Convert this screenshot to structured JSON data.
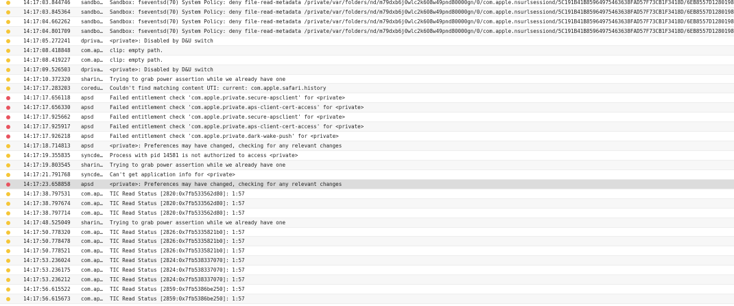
{
  "colors": {
    "info_dot": "#f5c637",
    "error_dot": "#e8535f",
    "selected_row": "#dcdcdc"
  },
  "log": {
    "rows": [
      {
        "time": "14:17:03.844746",
        "process": "sandbo…",
        "message": "Sandbox: fseventsd(70) System Policy: deny file-read-metadata /private/var/folders/nd/m79dxb6j0wlc2k608w49pnd80000gn/0/com.apple.nsurlsessiond/5C191B41B85964975463638FAD57F73CB1F3418D/6EB8557D1280198E18",
        "level": "info"
      },
      {
        "time": "14:17:03.845364",
        "process": "sandbo…",
        "message": "Sandbox: fseventsd(70) System Policy: deny file-read-metadata /private/var/folders/nd/m79dxb6j0wlc2k608w49pnd80000gn/0/com.apple.nsurlsessiond/5C191B41B85964975463638FAD57F73CB1F3418D/6EB8557D1280198E18",
        "level": "info"
      },
      {
        "time": "14:17:04.662262",
        "process": "sandbo…",
        "message": "Sandbox: fseventsd(70) System Policy: deny file-read-metadata /private/var/folders/nd/m79dxb6j0wlc2k608w49pnd80000gn/0/com.apple.nsurlsessiond/5C191B41B85964975463638FAD57F73CB1F3418D/6EB8557D1280198E18",
        "level": "info"
      },
      {
        "time": "14:17:04.801709",
        "process": "sandbo…",
        "message": "Sandbox: fseventsd(70) System Policy: deny file-read-metadata /private/var/folders/nd/m79dxb6j0wlc2k608w49pnd80000gn/0/com.apple.nsurlsessiond/5C191B41B85964975463638FAD57F73CB1F3418D/6EB8557D1280198E18",
        "level": "info"
      },
      {
        "time": "14:17:05.272241",
        "process": "dpriva…",
        "message": "<private>: Disabled by D&U switch",
        "level": "info"
      },
      {
        "time": "14:17:08.418848",
        "process": "com.ap…",
        "message": "clip: empty path.",
        "level": "info"
      },
      {
        "time": "14:17:08.419227",
        "process": "com.ap…",
        "message": "clip: empty path.",
        "level": "info"
      },
      {
        "time": "14:17:09.526503",
        "process": "dpriva…",
        "message": "<private>: Disabled by D&U switch",
        "level": "info"
      },
      {
        "time": "14:17:10.372320",
        "process": "sharin…",
        "message": "Trying to grab power assertion while we already have one",
        "level": "info"
      },
      {
        "time": "14:17:17.283203",
        "process": "coredu…",
        "message": "Couldn't find matching content UTI: current: com.apple.safari.history",
        "level": "info"
      },
      {
        "time": "14:17:17.656118",
        "process": "apsd",
        "message": "Failed entitlement check 'com.apple.private.secure-apsclient' for <private>",
        "level": "error"
      },
      {
        "time": "14:17:17.656330",
        "process": "apsd",
        "message": "Failed entitlement check 'com.apple.private.aps-client-cert-access' for <private>",
        "level": "error"
      },
      {
        "time": "14:17:17.925662",
        "process": "apsd",
        "message": "Failed entitlement check 'com.apple.private.secure-apsclient' for <private>",
        "level": "error"
      },
      {
        "time": "14:17:17.925917",
        "process": "apsd",
        "message": "Failed entitlement check 'com.apple.private.aps-client-cert-access' for <private>",
        "level": "error"
      },
      {
        "time": "14:17:17.926218",
        "process": "apsd",
        "message": "Failed entitlement check 'com.apple.private.dark-wake-push' for <private>",
        "level": "error"
      },
      {
        "time": "14:17:18.714813",
        "process": "apsd",
        "message": "<private>: Preferences may have changed, checking for any relevant changes",
        "level": "info"
      },
      {
        "time": "14:17:19.355835",
        "process": "syncde…",
        "message": "Process with pid 14581 is not authorized to access <private>",
        "level": "info"
      },
      {
        "time": "14:17:19.803545",
        "process": "sharin…",
        "message": "Trying to grab power assertion while we already have one",
        "level": "info"
      },
      {
        "time": "14:17:21.791768",
        "process": "syncde…",
        "message": "Can't get application info for <private>",
        "level": "info"
      },
      {
        "time": "14:17:23.658858",
        "process": "apsd",
        "message": "<private>: Preferences may have changed, checking for any relevant changes",
        "level": "error",
        "selected": true
      },
      {
        "time": "14:17:38.797531",
        "process": "com.ap…",
        "message": "TIC Read Status [2820:0x7fb533562d80]: 1:57",
        "level": "info"
      },
      {
        "time": "14:17:38.797674",
        "process": "com.ap…",
        "message": "TIC Read Status [2820:0x7fb533562d80]: 1:57",
        "level": "info"
      },
      {
        "time": "14:17:38.797714",
        "process": "com.ap…",
        "message": "TIC Read Status [2820:0x7fb533562d80]: 1:57",
        "level": "info"
      },
      {
        "time": "14:17:48.525049",
        "process": "sharin…",
        "message": "Trying to grab power assertion while we already have one",
        "level": "info"
      },
      {
        "time": "14:17:50.778320",
        "process": "com.ap…",
        "message": "TIC Read Status [2826:0x7fb5335821b0]: 1:57",
        "level": "info"
      },
      {
        "time": "14:17:50.778478",
        "process": "com.ap…",
        "message": "TIC Read Status [2826:0x7fb5335821b0]: 1:57",
        "level": "info"
      },
      {
        "time": "14:17:50.778521",
        "process": "com.ap…",
        "message": "TIC Read Status [2826:0x7fb5335821b0]: 1:57",
        "level": "info"
      },
      {
        "time": "14:17:53.236024",
        "process": "com.ap…",
        "message": "TIC Read Status [2824:0x7fb538337070]: 1:57",
        "level": "info"
      },
      {
        "time": "14:17:53.236175",
        "process": "com.ap…",
        "message": "TIC Read Status [2824:0x7fb538337070]: 1:57",
        "level": "info"
      },
      {
        "time": "14:17:53.236212",
        "process": "com.ap…",
        "message": "TIC Read Status [2824:0x7fb538337070]: 1:57",
        "level": "info"
      },
      {
        "time": "14:17:56.615522",
        "process": "com.ap…",
        "message": "TIC Read Status [2859:0x7fb5386be250]: 1:57",
        "level": "info"
      },
      {
        "time": "14:17:56.615673",
        "process": "com.ap…",
        "message": "TIC Read Status [2859:0x7fb5386be250]: 1:57",
        "level": "info"
      }
    ]
  }
}
